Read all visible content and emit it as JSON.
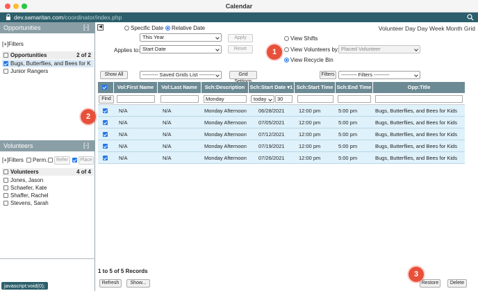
{
  "window": {
    "title": "Calendar"
  },
  "browser": {
    "host": "dev.samaritan.com",
    "path": "/coordinator/index.php"
  },
  "opportunities": {
    "title": "Opportunities",
    "collapse": "[-]",
    "filters_link": "[+]Filters",
    "list_header": "Opportunities",
    "count": "2 of 2",
    "items": [
      {
        "label": "Bugs, Butterflies, and Bees for K",
        "checked": true
      },
      {
        "label": "Junior Rangers",
        "checked": false
      }
    ]
  },
  "volunteers": {
    "title": "Volunteers",
    "collapse": "[-]",
    "filters_link": "[+]Filters",
    "perm_label": "Perm.",
    "refer_label": "Refer",
    "place_label": "Place",
    "list_header": "Volunteers",
    "count": "4 of 4",
    "items": [
      {
        "label": "Jones, Jason"
      },
      {
        "label": "Schaefer, Kate"
      },
      {
        "label": "Shaffer, Rachel"
      },
      {
        "label": "Stevens, Sarah"
      }
    ]
  },
  "status_bar": "javascript:void(0);",
  "controls": {
    "nav_arrow": "◀",
    "specific_date": "Specific Date",
    "relative_date": "Relative Date",
    "date_select": "This Year",
    "applies_to_label": "Applies to:",
    "applies_select": "Start Date",
    "apply_button": "Apply",
    "reset_button": "Reset",
    "view_shifts": "View Shifts",
    "view_volunteers_by": "View Volunteers by:",
    "volunteers_by_select": "Placed Volunteer",
    "view_recycle_bin": "View Recycle Bin",
    "header_links": "Volunteer Day  Day  Week  Month  Grid"
  },
  "grid_toolbar": {
    "show_all": "Show All",
    "saved_grids": "--------- Saved Grids List ---------",
    "grid_settings": "Grid Settings",
    "filters_button": "Filters",
    "filters_select": "--------- Filters ---------"
  },
  "grid": {
    "columns": [
      "Vol:First Name",
      "Vol:Last Name",
      "Sch:Description",
      "Sch:Start Date ▾1",
      "Sch:Start Time",
      "Sch:End Time",
      "Opp:Title"
    ],
    "find_button": "Find",
    "filter_description": "Monday",
    "filter_date_op": "today",
    "filter_date_value": "30",
    "rows": [
      {
        "first": "N/A",
        "last": "N/A",
        "desc": "Monday Afternoon",
        "date": "06/28/2021",
        "start": "12:00 pm",
        "end": "5:00 pm",
        "title": "Bugs, Butterflies, and Bees for Kids"
      },
      {
        "first": "N/A",
        "last": "N/A",
        "desc": "Monday Afternoon",
        "date": "07/05/2021",
        "start": "12:00 pm",
        "end": "5:00 pm",
        "title": "Bugs, Butterflies, and Bees for Kids"
      },
      {
        "first": "N/A",
        "last": "N/A",
        "desc": "Monday Afternoon",
        "date": "07/12/2021",
        "start": "12:00 pm",
        "end": "5:00 pm",
        "title": "Bugs, Butterflies, and Bees for Kids"
      },
      {
        "first": "N/A",
        "last": "N/A",
        "desc": "Monday Afternoon",
        "date": "07/19/2021",
        "start": "12:00 pm",
        "end": "5:00 pm",
        "title": "Bugs, Butterflies, and Bees for Kids"
      },
      {
        "first": "N/A",
        "last": "N/A",
        "desc": "Monday Afternoon",
        "date": "07/26/2021",
        "start": "12:00 pm",
        "end": "5:00 pm",
        "title": "Bugs, Butterflies, and Bees for Kids"
      }
    ]
  },
  "footer": {
    "records": "1 to 5 of 5 Records",
    "refresh": "Refresh",
    "show": "Show...",
    "restore": "Restore",
    "delete": "Delete"
  },
  "callouts": [
    "1",
    "2",
    "3"
  ],
  "colors": {
    "accent": "#2c5f6b",
    "grid_header": "#6c8a94",
    "row_bg": "#dff1fa",
    "callout": "#e8503a"
  }
}
